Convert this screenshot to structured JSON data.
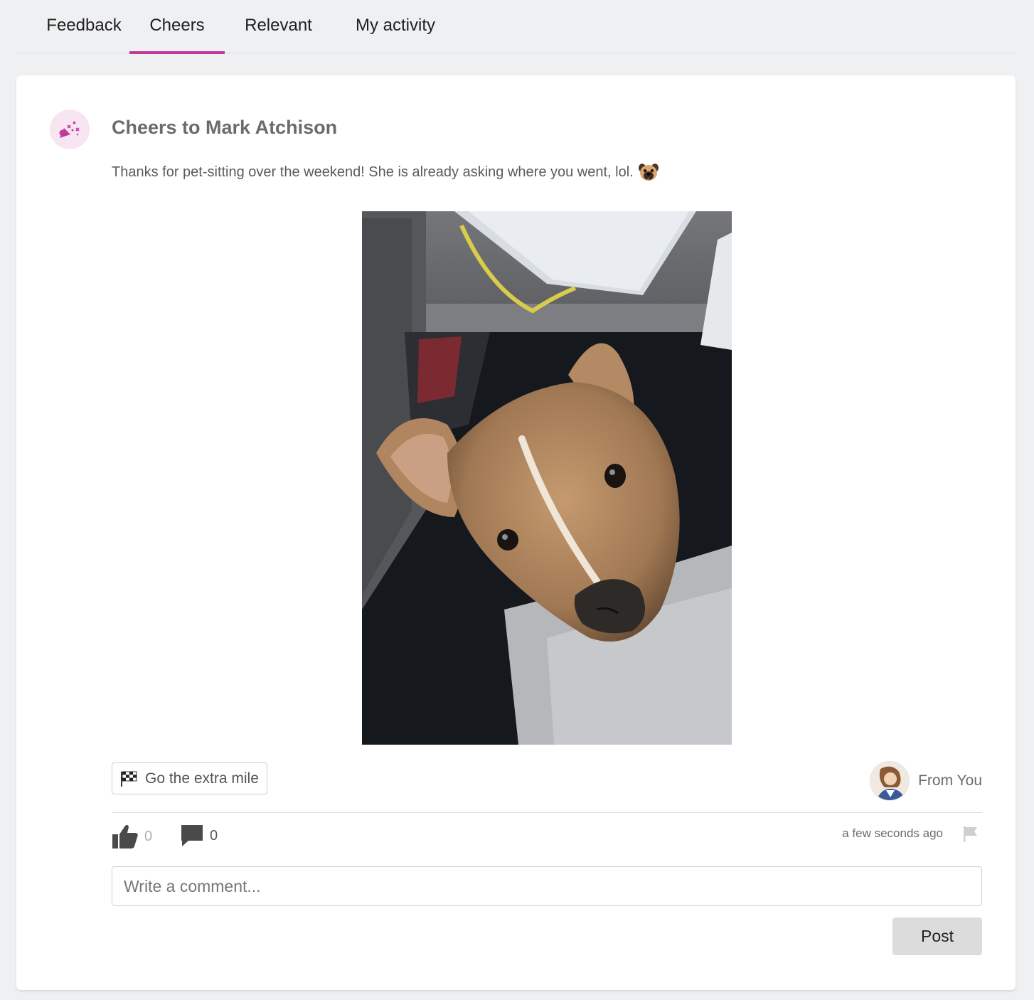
{
  "tabs": [
    {
      "label": "Feedback",
      "active": false
    },
    {
      "label": "Cheers",
      "active": true
    },
    {
      "label": "Relevant",
      "active": false
    },
    {
      "label": "My activity",
      "active": false
    }
  ],
  "post": {
    "title": "Cheers to Mark Atchison",
    "message": "Thanks for pet-sitting over the weekend! She is already asking where you went, lol.",
    "message_emoji": "pug-face-emoji",
    "cheer_icon": "party-popper-icon",
    "image_subject": "dog-photo",
    "value_tag": {
      "icon": "checkered-flag-icon",
      "label": "Go the extra mile"
    },
    "author": {
      "label": "From You"
    },
    "likes": "0",
    "comments": "0",
    "timestamp": "a few seconds ago"
  },
  "comment_input": {
    "placeholder": "Write a comment..."
  },
  "post_button": {
    "label": "Post"
  },
  "colors": {
    "accent": "#c2399c",
    "badge_bg": "#f7e6f2"
  }
}
